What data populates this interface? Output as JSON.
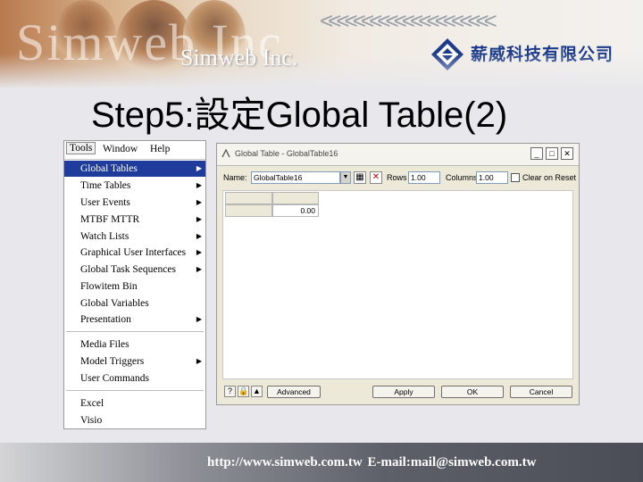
{
  "header": {
    "watermark": "Simweb Inc",
    "company_en": "Simweb Inc.",
    "company_cn": "薪威科技有限公司",
    "chevrons": "<<<<<<<<<<<<<<<<<<<<<",
    "logo_icon": "simweb-diamond-logo-icon"
  },
  "slide": {
    "title": "Step5:設定Global Table(2)"
  },
  "tools_menu": {
    "menubar": [
      "Tools",
      "Window",
      "Help"
    ],
    "items": [
      {
        "label": "Global Tables",
        "submenu": true,
        "selected": true
      },
      {
        "label": "Time Tables",
        "submenu": true
      },
      {
        "label": "User Events",
        "submenu": true
      },
      {
        "label": "MTBF MTTR",
        "submenu": true
      },
      {
        "label": "Watch Lists",
        "submenu": true
      },
      {
        "label": "Graphical User Interfaces",
        "submenu": true
      },
      {
        "label": "Global Task Sequences",
        "submenu": true
      },
      {
        "label": "Flowitem Bin",
        "submenu": false
      },
      {
        "label": "Global Variables",
        "submenu": false
      },
      {
        "label": "Presentation",
        "submenu": true
      },
      {
        "label": "Media Files",
        "submenu": false
      },
      {
        "label": "Model Triggers",
        "submenu": true
      },
      {
        "label": "User Commands",
        "submenu": false
      },
      {
        "label": "Excel",
        "submenu": false
      },
      {
        "label": "Visio",
        "submenu": false
      }
    ],
    "submenu_arrow": "▶",
    "selection_color": "#1f3c9c"
  },
  "global_table_window": {
    "title": "Global Table - GlobalTable16",
    "controls": {
      "minimize": "_",
      "maximize": "□",
      "close": "✕"
    },
    "name_label": "Name:",
    "name_value": "GlobalTable16",
    "rows_label": "Rows",
    "rows_value": "1.00",
    "columns_label": "Columns",
    "columns_value": "1.00",
    "clear_label": "Clear on Reset",
    "cell_value": "0.00",
    "buttons": {
      "advanced": "Advanced",
      "apply": "Apply",
      "ok": "OK",
      "cancel": "Cancel"
    },
    "icons": [
      "help-icon",
      "lock-icon",
      "tree-icon"
    ]
  },
  "footer": {
    "text": "http://www.simweb.com.tw   E-mail:mail@simweb.com.tw"
  }
}
